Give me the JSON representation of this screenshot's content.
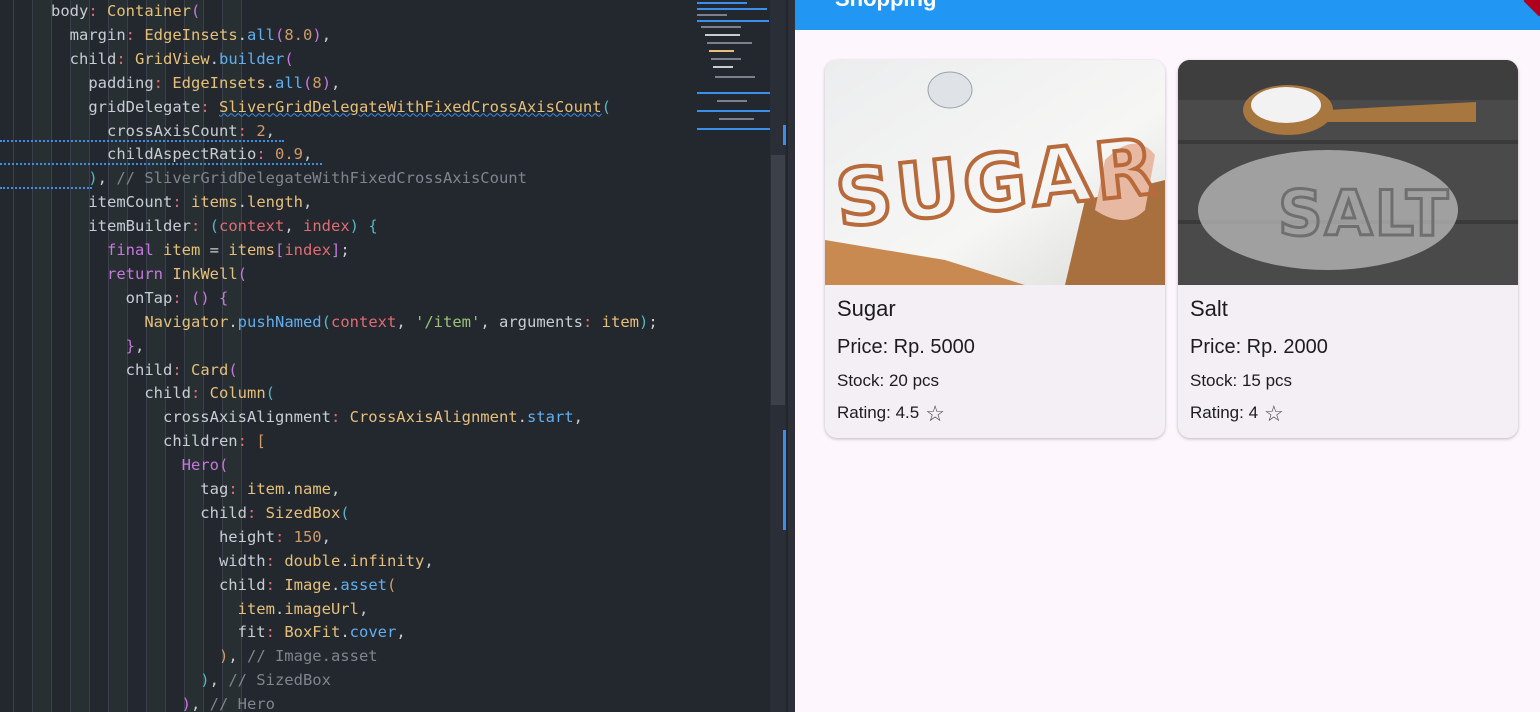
{
  "editor": {
    "lines": [
      [
        [
          "",
          "body"
        ],
        [
          "p",
          ": "
        ],
        [
          "t",
          "Container"
        ],
        [
          "br",
          "("
        ]
      ],
      [
        [
          "",
          "  margin"
        ],
        [
          "p",
          ": "
        ],
        [
          "t",
          "EdgeInsets"
        ],
        [
          "",
          "."
        ],
        [
          "f",
          "all"
        ],
        [
          "br",
          "("
        ],
        [
          "n",
          "8.0"
        ],
        [
          "br",
          ")"
        ],
        [
          "",
          ","
        ]
      ],
      [
        [
          "",
          "  child"
        ],
        [
          "p",
          ": "
        ],
        [
          "t",
          "GridView"
        ],
        [
          "",
          "."
        ],
        [
          "f",
          "builder"
        ],
        [
          "br",
          "("
        ]
      ],
      [
        [
          "",
          "    padding"
        ],
        [
          "p",
          ": "
        ],
        [
          "t",
          "EdgeInsets"
        ],
        [
          "",
          "."
        ],
        [
          "f",
          "all"
        ],
        [
          "br",
          "("
        ],
        [
          "n",
          "8"
        ],
        [
          "br",
          ")"
        ],
        [
          "",
          ","
        ]
      ],
      [
        [
          "",
          "    gridDelegate"
        ],
        [
          "p",
          ": "
        ],
        [
          "t squig",
          "SliverGridDelegateWithFixedCrossAxisCount"
        ],
        [
          "br2",
          "("
        ]
      ],
      [
        [
          "",
          "      crossAxisCount"
        ],
        [
          "p",
          ": "
        ],
        [
          "n",
          "2"
        ],
        [
          "",
          ","
        ]
      ],
      [
        [
          "",
          "      childAspectRatio"
        ],
        [
          "p",
          ": "
        ],
        [
          "n",
          "0.9"
        ],
        [
          "",
          ","
        ]
      ],
      [
        [
          "br2",
          "    )"
        ],
        [
          "",
          ", "
        ],
        [
          "c",
          "// SliverGridDelegateWithFixedCrossAxisCount"
        ]
      ],
      [
        [
          "",
          "    itemCount"
        ],
        [
          "p",
          ": "
        ],
        [
          "t",
          "items"
        ],
        [
          "",
          "."
        ],
        [
          "t",
          "length"
        ],
        [
          "",
          ","
        ]
      ],
      [
        [
          "",
          "    itemBuilder"
        ],
        [
          "p",
          ": "
        ],
        [
          "br2",
          "("
        ],
        [
          "p",
          "context"
        ],
        [
          "",
          ", "
        ],
        [
          "p",
          "index"
        ],
        [
          "br2",
          ")"
        ],
        [
          "",
          " "
        ],
        [
          "br2",
          "{"
        ]
      ],
      [
        [
          "k",
          "      final "
        ],
        [
          "t",
          "item"
        ],
        [
          "",
          " = "
        ],
        [
          "t",
          "items"
        ],
        [
          "br",
          "["
        ],
        [
          "p",
          "index"
        ],
        [
          "br",
          "]"
        ],
        [
          "",
          ";"
        ]
      ],
      [
        [
          "k",
          "      return "
        ],
        [
          "t",
          "InkWell"
        ],
        [
          "br",
          "("
        ]
      ],
      [
        [
          "",
          "        onTap"
        ],
        [
          "p",
          ": "
        ],
        [
          "br",
          "() {"
        ]
      ],
      [
        [
          "t",
          "          Navigator"
        ],
        [
          "",
          "."
        ],
        [
          "f",
          "pushNamed"
        ],
        [
          "br2",
          "("
        ],
        [
          "p",
          "context"
        ],
        [
          "",
          ", "
        ],
        [
          "s",
          "'/item'"
        ],
        [
          "",
          ", arguments"
        ],
        [
          "p",
          ": "
        ],
        [
          "t",
          "item"
        ],
        [
          "br2",
          ")"
        ],
        [
          "",
          ";"
        ]
      ],
      [
        [
          "br",
          "        }"
        ],
        [
          "",
          ","
        ]
      ],
      [
        [
          "",
          "        child"
        ],
        [
          "p",
          ": "
        ],
        [
          "t",
          "Card"
        ],
        [
          "br",
          "("
        ]
      ],
      [
        [
          "",
          "          child"
        ],
        [
          "p",
          ": "
        ],
        [
          "t",
          "Column"
        ],
        [
          "br2",
          "("
        ]
      ],
      [
        [
          "",
          "            crossAxisAlignment"
        ],
        [
          "p",
          ": "
        ],
        [
          "t",
          "CrossAxisAlignment"
        ],
        [
          "",
          "."
        ],
        [
          "f",
          "start"
        ],
        [
          "",
          ","
        ]
      ],
      [
        [
          "",
          "            children"
        ],
        [
          "p",
          ": "
        ],
        [
          "n",
          "["
        ]
      ],
      [
        [
          "k",
          "              Hero"
        ],
        [
          "br",
          "("
        ]
      ],
      [
        [
          "",
          "                tag"
        ],
        [
          "p",
          ": "
        ],
        [
          "t",
          "item"
        ],
        [
          "",
          "."
        ],
        [
          "t",
          "name"
        ],
        [
          "",
          ","
        ]
      ],
      [
        [
          "",
          "                child"
        ],
        [
          "p",
          ": "
        ],
        [
          "t",
          "SizedBox"
        ],
        [
          "br2",
          "("
        ]
      ],
      [
        [
          "",
          "                  height"
        ],
        [
          "p",
          ": "
        ],
        [
          "n",
          "150"
        ],
        [
          "",
          ","
        ]
      ],
      [
        [
          "",
          "                  width"
        ],
        [
          "p",
          ": "
        ],
        [
          "t",
          "double"
        ],
        [
          "",
          "."
        ],
        [
          "t",
          "infinity"
        ],
        [
          "",
          ","
        ]
      ],
      [
        [
          "",
          "                  child"
        ],
        [
          "p",
          ": "
        ],
        [
          "t",
          "Image"
        ],
        [
          "",
          "."
        ],
        [
          "f",
          "asset"
        ],
        [
          "n",
          "("
        ]
      ],
      [
        [
          "t",
          "                    item"
        ],
        [
          "",
          "."
        ],
        [
          "t",
          "imageUrl"
        ],
        [
          "",
          ","
        ]
      ],
      [
        [
          "",
          "                    fit"
        ],
        [
          "p",
          ": "
        ],
        [
          "t",
          "BoxFit"
        ],
        [
          "",
          "."
        ],
        [
          "f",
          "cover"
        ],
        [
          "",
          ","
        ]
      ],
      [
        [
          "n",
          "                  )"
        ],
        [
          "",
          ", "
        ],
        [
          "c",
          "// Image.asset"
        ]
      ],
      [
        [
          "br2",
          "                )"
        ],
        [
          "",
          ", "
        ],
        [
          "c",
          "// SizedBox"
        ]
      ],
      [
        [
          "br",
          "              )"
        ],
        [
          "",
          ", "
        ],
        [
          "c",
          "// Hero"
        ]
      ]
    ]
  },
  "app": {
    "title": "Shopping",
    "products": [
      {
        "name": "Sugar",
        "price": "Price: Rp. 5000",
        "stock": "Stock: 20 pcs",
        "rating": "Rating: 4.5",
        "rating_value": 4.5,
        "image_word": "SUGAR",
        "icon": "star-outline-icon"
      },
      {
        "name": "Salt",
        "price": "Price: Rp. 2000",
        "stock": "Stock: 15 pcs",
        "rating": "Rating: 4",
        "rating_value": 4,
        "image_word": "SALT",
        "icon": "star-outline-icon"
      }
    ],
    "colors": {
      "appbar": "#2196f3",
      "background": "#fdf6fd",
      "card": "#f4eff5"
    }
  }
}
